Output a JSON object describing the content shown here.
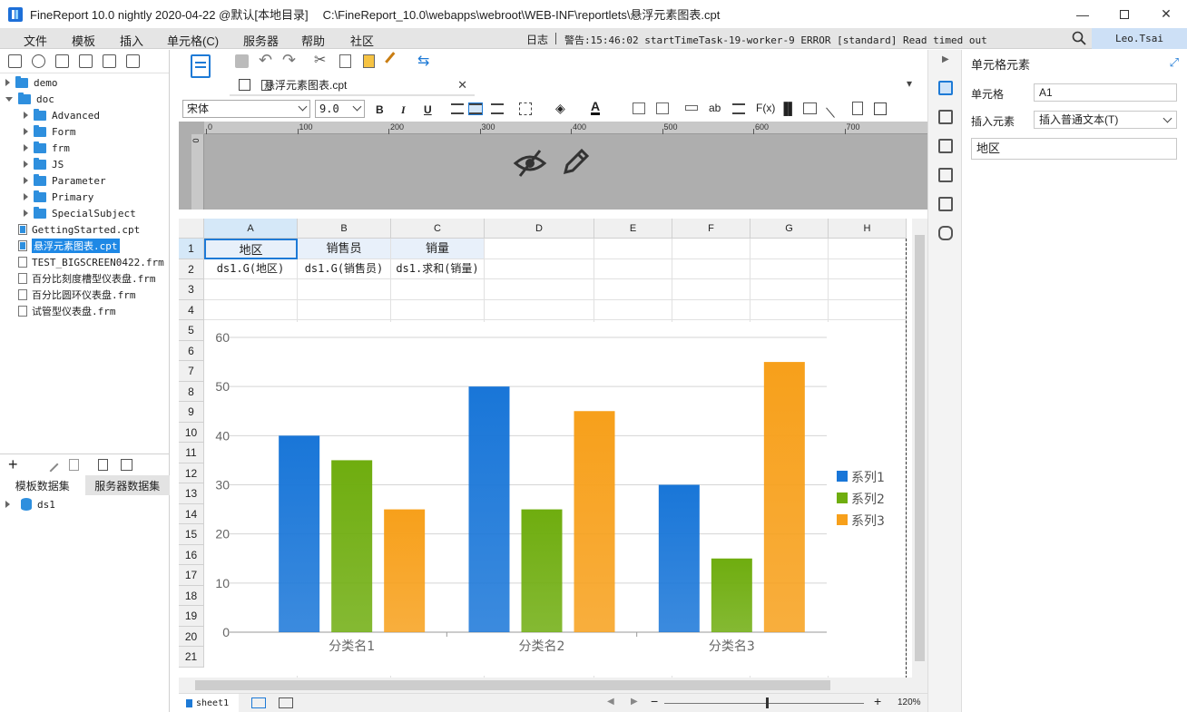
{
  "window": {
    "app_title": "FineReport 10.0 nightly 2020-04-22 @默认[本地目录]",
    "file_path": "C:\\FineReport_10.0\\webapps\\webroot\\WEB-INF\\reportlets\\悬浮元素图表.cpt"
  },
  "menu": [
    "文件",
    "模板",
    "插入",
    "单元格(C)",
    "服务器",
    "帮助",
    "社区"
  ],
  "log": {
    "label": "日志",
    "message": "警告:15:46:02 startTimeTask-19-worker-9 ERROR [standard] Read timed out"
  },
  "user": "Leo.Tsai",
  "file_tree": [
    {
      "label": "demo",
      "kind": "folder",
      "level": 0,
      "open": false
    },
    {
      "label": "doc",
      "kind": "folder",
      "level": 0,
      "open": true
    },
    {
      "label": "Advanced",
      "kind": "folder",
      "level": 1,
      "open": false
    },
    {
      "label": "Form",
      "kind": "folder",
      "level": 1,
      "open": false
    },
    {
      "label": "frm",
      "kind": "folder",
      "level": 1,
      "open": false
    },
    {
      "label": "JS",
      "kind": "folder",
      "level": 1,
      "open": false
    },
    {
      "label": "Parameter",
      "kind": "folder",
      "level": 1,
      "open": false
    },
    {
      "label": "Primary",
      "kind": "folder",
      "level": 1,
      "open": false
    },
    {
      "label": "SpecialSubject",
      "kind": "folder",
      "level": 1,
      "open": false
    },
    {
      "label": "GettingStarted.cpt",
      "kind": "cpt",
      "level": 0
    },
    {
      "label": "悬浮元素图表.cpt",
      "kind": "cpt",
      "level": 0,
      "selected": true
    },
    {
      "label": "TEST_BIGSCREEN0422.frm",
      "kind": "frm",
      "level": 0
    },
    {
      "label": "百分比刻度槽型仪表盘.frm",
      "kind": "frm",
      "level": 0
    },
    {
      "label": "百分比圆环仪表盘.frm",
      "kind": "frm",
      "level": 0
    },
    {
      "label": "试管型仪表盘.frm",
      "kind": "frm",
      "level": 0
    }
  ],
  "dataset_tabs": [
    "模板数据集",
    "服务器数据集"
  ],
  "datasets": [
    "ds1"
  ],
  "editor_tab": "悬浮元素图表.cpt",
  "format": {
    "font": "宋体",
    "size": "9.0"
  },
  "ruler": [
    "0",
    "100",
    "200",
    "300",
    "400",
    "500",
    "600",
    "700"
  ],
  "ruler_v": "0",
  "columns": [
    "A",
    "B",
    "C",
    "D",
    "E",
    "F",
    "G",
    "H"
  ],
  "rows": [
    "1",
    "2",
    "3",
    "4",
    "5",
    "6",
    "7",
    "8",
    "9",
    "10",
    "11",
    "12",
    "13",
    "14",
    "15",
    "16",
    "17",
    "18",
    "19",
    "20",
    "21"
  ],
  "cells": {
    "A1": "地区",
    "B1": "销售员",
    "C1": "销量",
    "A2": "ds1.G(地区)",
    "B2": "ds1.G(销售员)",
    "C2": "ds1.求和(销量)"
  },
  "sheet_tab": "sheet1",
  "zoom": "120%",
  "right_panel": {
    "title": "单元格元素",
    "cell_label": "单元格",
    "cell_value": "A1",
    "insert_label": "插入元素",
    "insert_value": "插入普通文本(T)",
    "content": "地区"
  },
  "chart_data": {
    "type": "bar",
    "categories": [
      "分类名1",
      "分类名2",
      "分类名3"
    ],
    "series": [
      {
        "name": "系列1",
        "values": [
          40,
          50,
          30
        ],
        "color": "#1976d8"
      },
      {
        "name": "系列2",
        "values": [
          35,
          25,
          15
        ],
        "color": "#6fad0f"
      },
      {
        "name": "系列3",
        "values": [
          25,
          45,
          55
        ],
        "color": "#f7a01b"
      }
    ],
    "yticks": [
      "0",
      "10",
      "20",
      "30",
      "40",
      "50",
      "60"
    ],
    "ylim": [
      0,
      60
    ],
    "grid": true,
    "legend": "right"
  }
}
